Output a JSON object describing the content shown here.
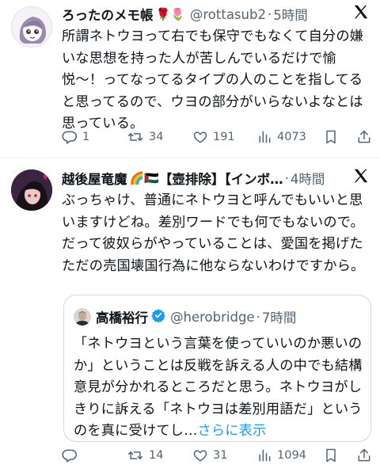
{
  "tweet1": {
    "name": "ろったのメモ帳",
    "name_emoji": "🌹🌷",
    "handle": "@rottasub2",
    "dot": "·",
    "time": "5時間",
    "text": "所謂ネトウヨって右でも保守でもなくて自分の嫌いな思想を持った人が苦しんでいるだけで愉悦〜！ってなってるタイプの人のことを指してると思ってるので、ウヨの部分がいらないよなとは思っている。",
    "reply_count": "1",
    "retweet_count": "34",
    "like_count": "191",
    "view_count": "4073"
  },
  "tweet2": {
    "name": "越後屋竜魔",
    "name_emoji": "🌈🇵🇸",
    "name_suffix": "【壺排除】【インボ…",
    "dot": "·",
    "time": "4時間",
    "text": "ぶっちゃけ、普通にネトウヨと呼んでもいいと思いますけどね。差別ワードでも何でもないので。だって彼奴らがやっていることは、愛国を掲げたただの売国壊国行為に他ならないわけですから。",
    "reply_count": "",
    "retweet_count": "14",
    "like_count": "31",
    "view_count": "1094"
  },
  "quote": {
    "name": "高橋裕行",
    "handle": "@herobridge",
    "dot": "·",
    "time": "7時間",
    "text": "「ネトウヨという言葉を使っていいのか悪いのか」ということは反戦を訴える人の中でも結構意見が分かれるところだと思う。ネトウヨがしきりに訴える「ネトウヨは差別用語だ」というのを真に受けてし…",
    "show_more": "さらに表示"
  },
  "icons": {
    "x_logo": "x-logo-icon",
    "reply": "reply-icon",
    "retweet": "retweet-icon",
    "like": "heart-icon",
    "views": "views-icon",
    "bookmark": "bookmark-icon",
    "share": "share-icon",
    "verified": "verified-badge-icon"
  },
  "colors": {
    "text": "#0f1419",
    "secondary": "#536471",
    "link": "#1d9bf0",
    "border": "#cfd9de",
    "verified": "#1d9bf0"
  }
}
